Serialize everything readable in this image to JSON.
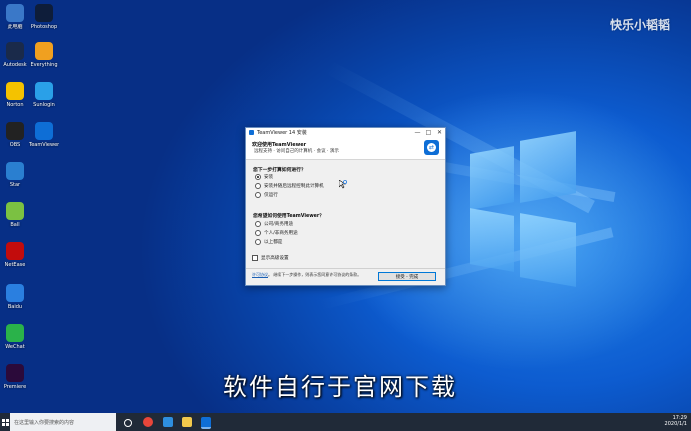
{
  "watermark": "快乐小韬韬",
  "subtitle": "软件自行于官网下载",
  "desktop_icons": [
    {
      "label": "此电脑",
      "icon": "computer-icon",
      "color": "#3a78c8"
    },
    {
      "label": "Photoshop",
      "icon": "photoshop-icon",
      "color": "#0e1d3a"
    },
    {
      "label": "Autodesk",
      "icon": "autodesk-icon",
      "color": "#1a2a4a"
    },
    {
      "label": "Everything",
      "icon": "search-app-icon",
      "color": "#f0a020"
    },
    {
      "label": "Norton",
      "icon": "norton-icon",
      "color": "#f4c200"
    },
    {
      "label": "Sunlogin",
      "icon": "sunlogin-icon",
      "color": "#2aa0e8"
    },
    {
      "label": "OBS",
      "icon": "obs-icon",
      "color": "#222"
    },
    {
      "label": "TeamViewer",
      "icon": "teamviewer-icon",
      "color": "#0e6ed6"
    },
    {
      "label": "Star",
      "icon": "star-icon",
      "color": "#2a7fd0"
    },
    {
      "label": "Ball",
      "icon": "ball-icon",
      "color": "#7bc142"
    },
    {
      "label": "NetEase",
      "icon": "music-icon",
      "color": "#c20c0c"
    },
    {
      "label": "Baidu",
      "icon": "cloud-icon",
      "color": "#2a7fe0"
    },
    {
      "label": "WeChat",
      "icon": "wechat-icon",
      "color": "#2ab24a"
    },
    {
      "label": "Premiere",
      "icon": "premiere-icon",
      "color": "#2b0a3a"
    }
  ],
  "dialog": {
    "title": "TeamViewer 14 安装",
    "header_title": "欢迎使用TeamViewer",
    "header_sub": "远程支持 · 访问自己的计算机 · 会议 · 演示",
    "q1": "您下一步打算如何进行？",
    "q1_options": [
      "安装",
      "安装并随后远程控制此计算机",
      "仅运行"
    ],
    "q2": "您希望如何使用TeamViewer？",
    "q2_options": [
      "公司/商务用途",
      "个人/非商务用途",
      "以上都是"
    ],
    "advanced": "显示高级设置",
    "footer_link": "许可协议",
    "footer_text": "。 继续下一步操作，则表示您同意许可协议的条款。",
    "accept_button": "接受 - 完成",
    "controls": [
      "—",
      "□",
      "✕"
    ]
  },
  "taskbar": {
    "search_placeholder": "在这里输入你要搜索的内容",
    "time": "17:29",
    "date": "2020/1/1"
  }
}
